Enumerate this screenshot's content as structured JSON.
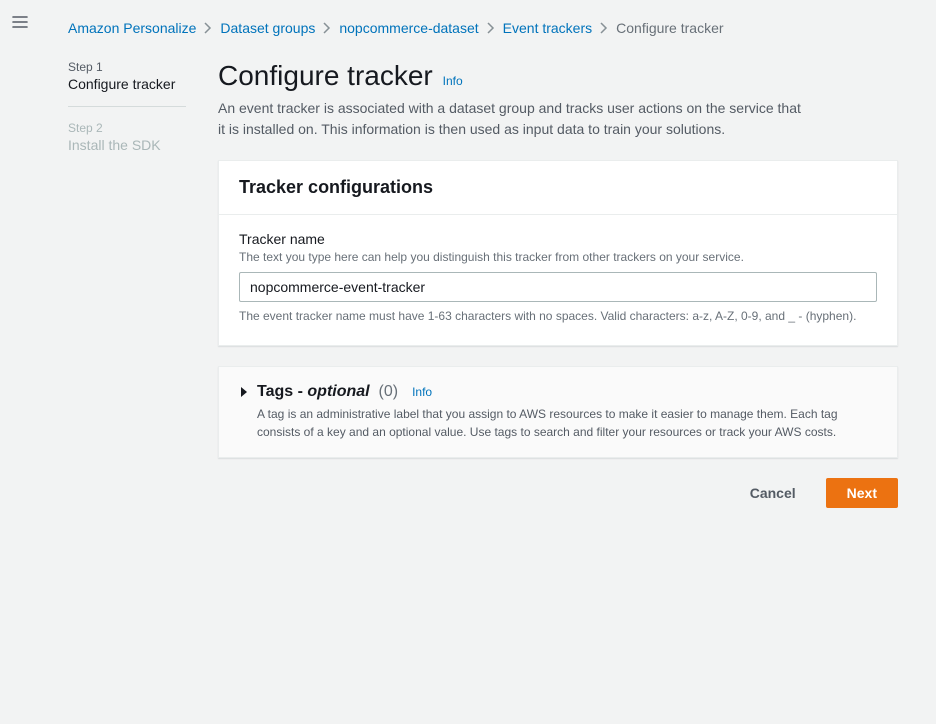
{
  "breadcrumbs": {
    "items": [
      {
        "label": "Amazon Personalize"
      },
      {
        "label": "Dataset groups"
      },
      {
        "label": "nopcommerce-dataset"
      },
      {
        "label": "Event trackers"
      }
    ],
    "current": "Configure tracker"
  },
  "steps": {
    "step1": {
      "num": "Step 1",
      "title": "Configure tracker"
    },
    "step2": {
      "num": "Step 2",
      "title": "Install the SDK"
    }
  },
  "header": {
    "title": "Configure tracker",
    "info": "Info",
    "description": "An event tracker is associated with a dataset group and tracks user actions on the service that it is installed on. This information is then used as input data to train your solutions."
  },
  "tracker_panel": {
    "title": "Tracker configurations",
    "name_label": "Tracker name",
    "name_hint": "The text you type here can help you distinguish this tracker from other trackers on your service.",
    "name_value": "nopcommerce-event-tracker",
    "name_constraint": "The event tracker name must have 1-63 characters with no spaces. Valid characters: a-z, A-Z, 0-9, and _ - (hyphen)."
  },
  "tags_panel": {
    "title_prefix": "Tags -",
    "optional": "optional",
    "count": "(0)",
    "info": "Info",
    "description": "A tag is an administrative label that you assign to AWS resources to make it easier to manage them. Each tag consists of a key and an optional value. Use tags to search and filter your resources or track your AWS costs."
  },
  "actions": {
    "cancel": "Cancel",
    "next": "Next"
  },
  "colors": {
    "primary": "#ec7211",
    "link": "#0073bb"
  }
}
